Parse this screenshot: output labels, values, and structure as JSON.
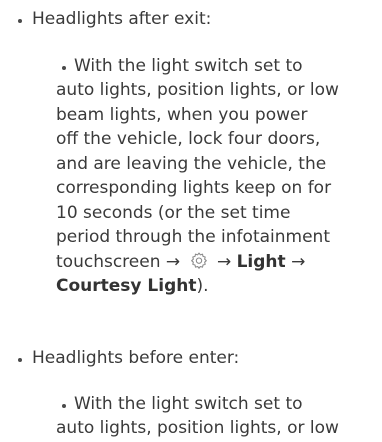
{
  "sections": [
    {
      "heading": "Headlights after exit:",
      "detail_lines": [
        "With the light switch set to",
        "auto lights, position lights, or low",
        "beam lights, when you power",
        "off the vehicle, lock four doors,",
        "and are leaving the vehicle, the",
        "corresponding lights keep on for",
        "10 seconds (or the set time",
        "period through the infotainment"
      ],
      "path_prefix": "touchscreen →",
      "path_arrow_1": "→",
      "path_light": "Light",
      "path_arrow_2": "→",
      "path_courtesy": "Courtesy Light",
      "path_suffix": ")."
    },
    {
      "heading": "Headlights before enter:",
      "detail_lines": [
        "With the light switch set to",
        "auto lights, position lights, or low"
      ]
    }
  ],
  "icons": {
    "settings": "gear-icon"
  },
  "colors": {
    "text": "#3a3a3a",
    "icon_stroke": "#8a8a8a"
  }
}
